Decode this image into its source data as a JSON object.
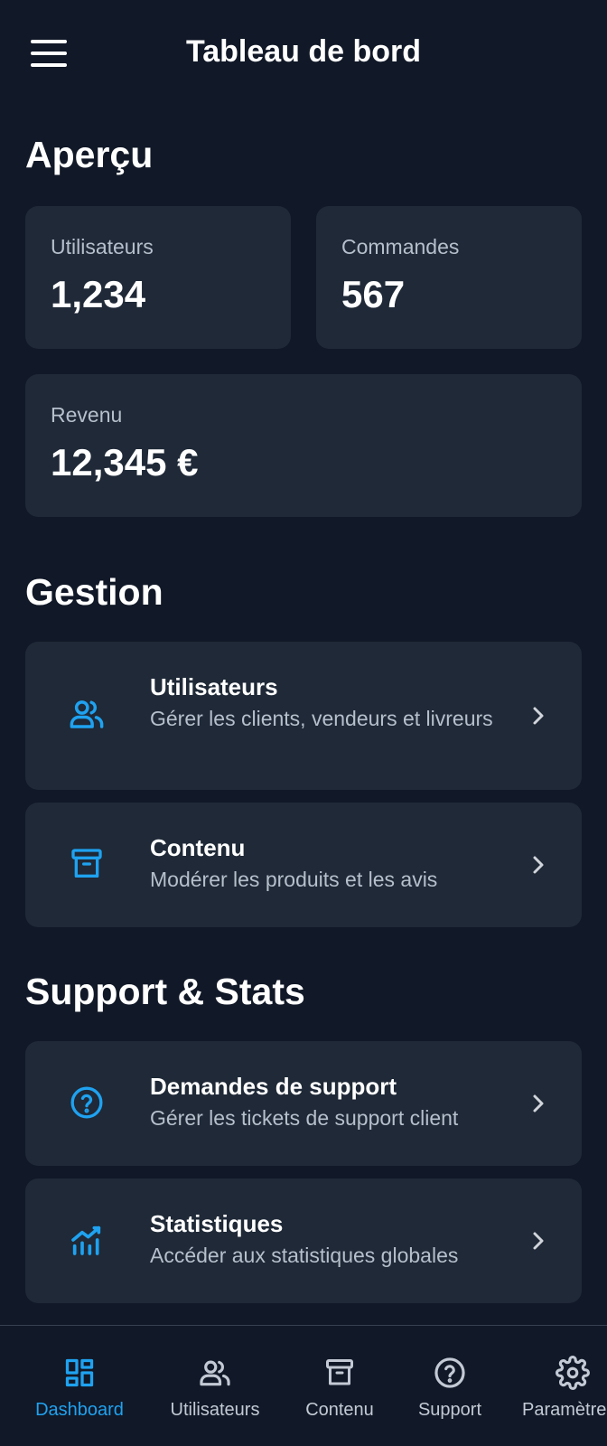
{
  "header": {
    "title": "Tableau de bord"
  },
  "sections": {
    "overview": "Aperçu",
    "management": "Gestion",
    "support_stats": "Support & Stats"
  },
  "stats": [
    {
      "label": "Utilisateurs",
      "value": "1,234"
    },
    {
      "label": "Commandes",
      "value": "567"
    },
    {
      "label": "Revenu",
      "value": "12,345 €"
    }
  ],
  "management": [
    {
      "title": "Utilisateurs",
      "desc": "Gérer les clients, vendeurs et livreurs",
      "icon": "users-icon"
    },
    {
      "title": "Contenu",
      "desc": "Modérer les produits et les avis",
      "icon": "archive-icon"
    }
  ],
  "support": [
    {
      "title": "Demandes de support",
      "desc": "Gérer les tickets de support client",
      "icon": "help-circle-icon"
    },
    {
      "title": "Statistiques",
      "desc": "Accéder aux statistiques globales",
      "icon": "chart-icon"
    }
  ],
  "nav": [
    {
      "label": "Dashboard",
      "icon": "dashboard-icon",
      "active": true
    },
    {
      "label": "Utilisateurs",
      "icon": "users-icon",
      "active": false
    },
    {
      "label": "Contenu",
      "icon": "archive-icon",
      "active": false
    },
    {
      "label": "Support",
      "icon": "help-circle-icon",
      "active": false
    },
    {
      "label": "Paramètres",
      "icon": "gear-icon",
      "active": false
    }
  ],
  "colors": {
    "background": "#111827",
    "card": "#1f2937",
    "accent": "#1fa2f0",
    "muted_text": "#b6bfcc"
  }
}
